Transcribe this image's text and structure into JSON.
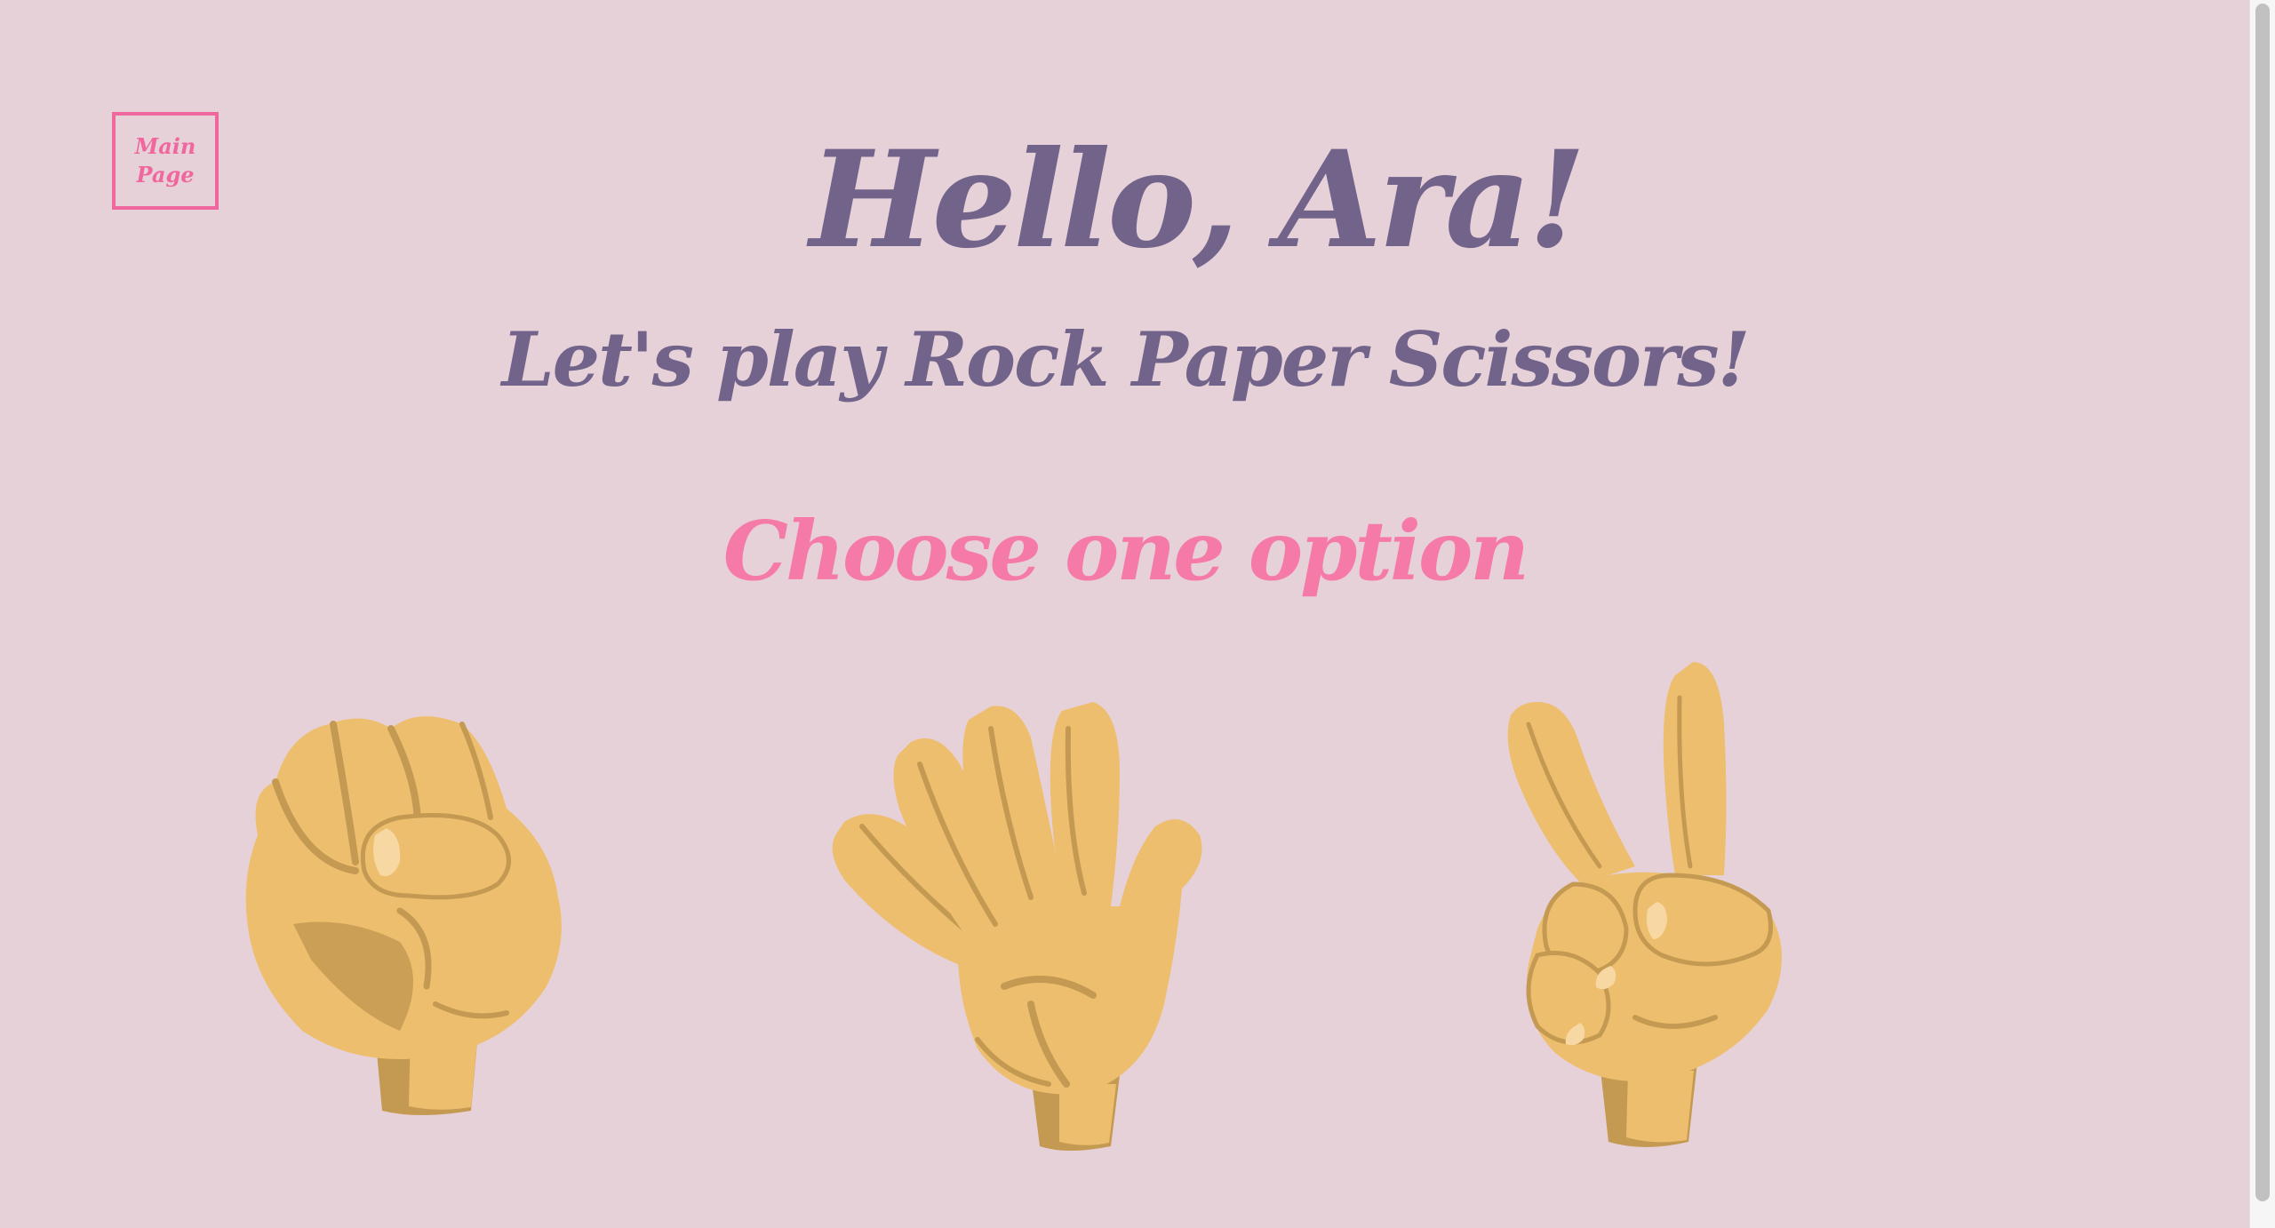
{
  "nav": {
    "main_page_label": "Main Page"
  },
  "header": {
    "greeting": "Hello, Ara!",
    "subtitle": "Let's play Rock Paper Scissors!"
  },
  "prompt": {
    "label": "Choose one option"
  },
  "options": [
    {
      "icon": "rock-hand-icon"
    },
    {
      "icon": "paper-hand-icon"
    },
    {
      "icon": "scissors-hand-icon"
    }
  ],
  "colors": {
    "background": "#e7d1d9",
    "heading": "#72638a",
    "accent": "#f0679e",
    "skin": "#edbe6e",
    "skin_shadow": "#c49a52"
  }
}
